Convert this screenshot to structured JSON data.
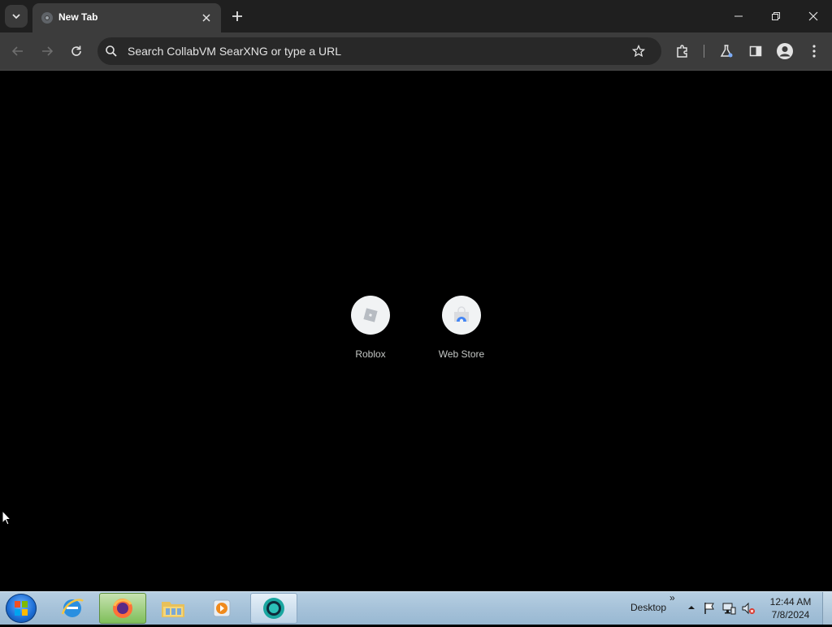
{
  "browser": {
    "tab": {
      "title": "New Tab"
    },
    "omnibox": {
      "placeholder": "Search CollabVM SearXNG or type a URL"
    }
  },
  "ntp": {
    "shortcuts": [
      {
        "label": "Roblox",
        "icon": "roblox-icon"
      },
      {
        "label": "Web Store",
        "icon": "web-store-icon"
      }
    ]
  },
  "taskbar": {
    "apps": [
      "internet-explorer-icon",
      "firefox-icon",
      "file-explorer-icon",
      "media-player-icon",
      "chrome-icon"
    ],
    "desktop_label": "Desktop",
    "chevron": "»",
    "clock": {
      "time": "12:44 AM",
      "date": "7/8/2024"
    }
  },
  "colors": {
    "page_background": "#000000",
    "tabstrip": "#1f1f1f",
    "toolbar": "#3c3c3c",
    "omnibox": "#282828",
    "taskbar": "#a6c2d9"
  }
}
